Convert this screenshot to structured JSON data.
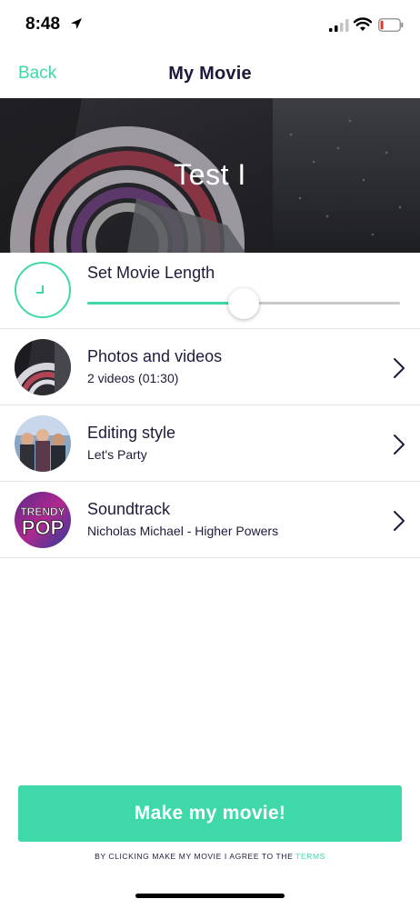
{
  "status_bar": {
    "time": "8:48",
    "icons": [
      "location-arrow-icon",
      "cellular-signal-icon",
      "wifi-icon",
      "battery-icon"
    ]
  },
  "nav": {
    "back_label": "Back",
    "title": "My Movie"
  },
  "hero": {
    "title": "Test I"
  },
  "movie_length": {
    "label": "Set Movie Length",
    "icon": "clock-icon",
    "slider_fraction": 0.5
  },
  "items": [
    {
      "title": "Photos and videos",
      "subtitle": "2 videos (01:30)",
      "icon": "chevron-right-icon"
    },
    {
      "title": "Editing style",
      "subtitle": "Let's Party",
      "icon": "chevron-right-icon"
    },
    {
      "title": "Soundtrack",
      "subtitle": "Nicholas Michael - Higher Powers",
      "icon": "chevron-right-icon"
    }
  ],
  "soundtrack_art": {
    "line1": "TRENDY",
    "line2": "POP"
  },
  "cta": {
    "label": "Make my movie!"
  },
  "terms": {
    "prefix": "BY CLICKING MAKE MY MOVIE I AGREE TO THE",
    "link": "TERMS"
  },
  "colors": {
    "accent": "#3fd8a8",
    "text": "#1e1b3a",
    "divider": "#e4e4e8"
  }
}
